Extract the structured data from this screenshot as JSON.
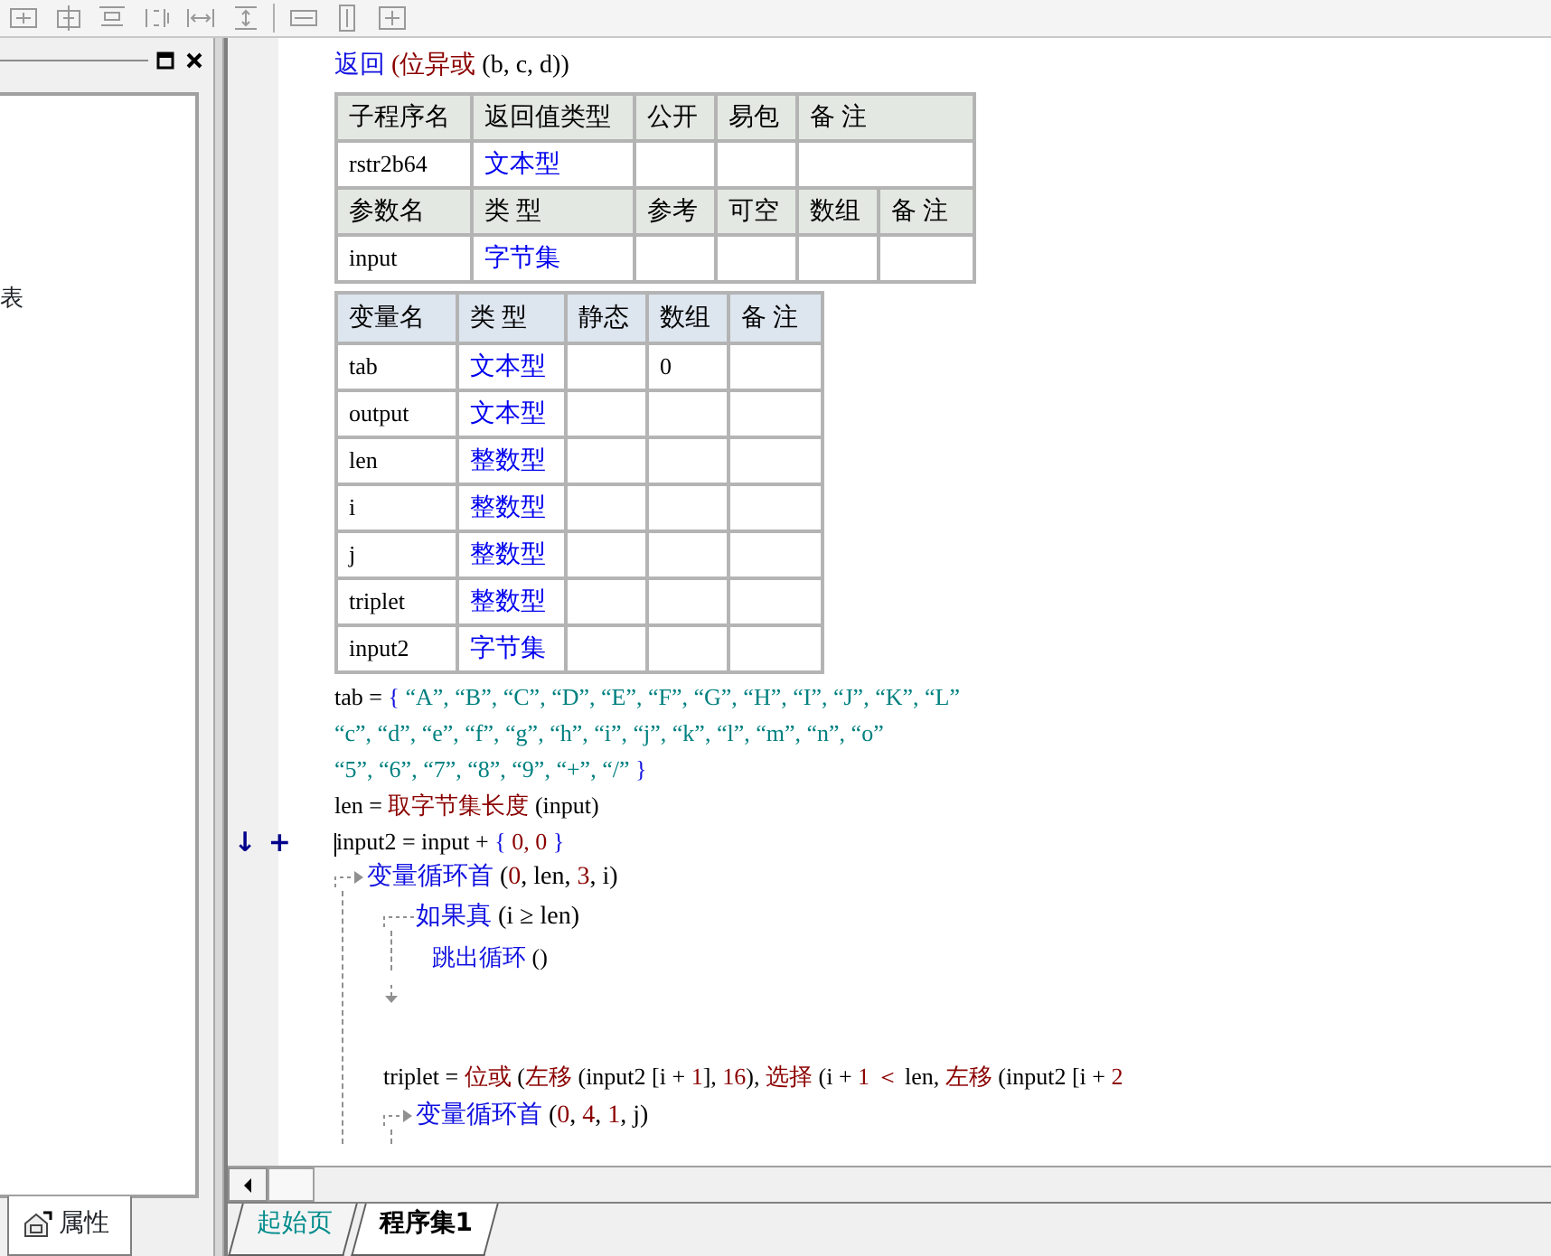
{
  "left_panel": {
    "list_text": "表",
    "tabs": [
      {
        "label": "属性",
        "selected": true
      }
    ]
  },
  "editor": {
    "return_line": [
      {
        "kind": "kw",
        "text": "返回"
      },
      {
        "kind": "fn",
        "text": " (位异或"
      },
      {
        "kind": "plain",
        "text": " (b, c, d))"
      }
    ],
    "sub_table": {
      "columns": [
        "子程序名",
        "返回值类型",
        "公开",
        "易包",
        "备 注"
      ],
      "row": {
        "name": "rstr2b64",
        "return_type": "文本型"
      }
    },
    "param_table": {
      "columns": [
        "参数名",
        "类 型",
        "参考",
        "可空",
        "数组",
        "备 注"
      ],
      "rows": [
        {
          "name": "input",
          "type": "字节集"
        }
      ]
    },
    "var_table": {
      "columns": [
        "变量名",
        "类 型",
        "静态",
        "数组",
        "备 注"
      ],
      "rows": [
        {
          "name": "tab",
          "type": "文本型",
          "array": "0"
        },
        {
          "name": "output",
          "type": "文本型"
        },
        {
          "name": "len",
          "type": "整数型"
        },
        {
          "name": "i",
          "type": "整数型"
        },
        {
          "name": "j",
          "type": "整数型"
        },
        {
          "name": "triplet",
          "type": "整数型"
        },
        {
          "name": "input2",
          "type": "字节集"
        }
      ]
    },
    "code": [
      {
        "kind": "line",
        "segments": [
          {
            "kind": "plain",
            "text": "tab = "
          },
          {
            "kind": "brace",
            "text": "{ "
          },
          {
            "kind": "str",
            "text": "“A”, “B”, “C”, “D”, “E”, “F”, “G”, “H”, “I”, “J”, “K”, “L”"
          }
        ]
      },
      {
        "kind": "line",
        "segments": [
          {
            "kind": "str",
            "text": "“c”, “d”, “e”, “f”, “g”, “h”, “i”, “j”, “k”, “l”, “m”, “n”, “o”"
          }
        ]
      },
      {
        "kind": "line",
        "segments": [
          {
            "kind": "str",
            "text": "“5”, “6”, “7”, “8”, “9”, “+”, “/”"
          },
          {
            "kind": "brace",
            "text": " }"
          }
        ]
      },
      {
        "kind": "line",
        "segments": [
          {
            "kind": "plain",
            "text": "len = "
          },
          {
            "kind": "fn",
            "text": "取字节集长度"
          },
          {
            "kind": "plain",
            "text": " (input)"
          }
        ]
      },
      {
        "kind": "line",
        "gutter_marks": [
          "↓",
          "+"
        ],
        "cursor": true,
        "segments": [
          {
            "kind": "plain",
            "text": "input2 = input + "
          },
          {
            "kind": "brace",
            "text": "{ "
          },
          {
            "kind": "num",
            "text": "0, 0"
          },
          {
            "kind": "brace",
            "text": " }"
          }
        ]
      },
      {
        "kind": "loop",
        "segments": [
          {
            "kind": "kw",
            "text": "变量循环首"
          },
          {
            "kind": "plain",
            "text": " ("
          },
          {
            "kind": "num",
            "text": "0"
          },
          {
            "kind": "plain",
            "text": ", len, "
          },
          {
            "kind": "num",
            "text": "3"
          },
          {
            "kind": "plain",
            "text": ", i)"
          }
        ],
        "children": [
          {
            "kind": "if",
            "segments": [
              {
                "kind": "kw",
                "text": "如果真"
              },
              {
                "kind": "plain",
                "text": " (i ≥ len)"
              }
            ],
            "children": [
              {
                "kind": "line",
                "segments": [
                  {
                    "kind": "kw",
                    "text": "跳出循环"
                  },
                  {
                    "kind": "plain",
                    "text": " ()"
                  }
                ]
              }
            ]
          },
          {
            "kind": "blank"
          },
          {
            "kind": "line",
            "segments": [
              {
                "kind": "plain",
                "text": "triplet = "
              },
              {
                "kind": "fn",
                "text": "位或"
              },
              {
                "kind": "plain",
                "text": " ("
              },
              {
                "kind": "fn",
                "text": "左移"
              },
              {
                "kind": "plain",
                "text": " (input2 [i + "
              },
              {
                "kind": "num",
                "text": "1"
              },
              {
                "kind": "plain",
                "text": "], "
              },
              {
                "kind": "num",
                "text": "16"
              },
              {
                "kind": "plain",
                "text": "), "
              },
              {
                "kind": "fn",
                "text": "选择"
              },
              {
                "kind": "plain",
                "text": " (i + "
              },
              {
                "kind": "num",
                "text": "1"
              },
              {
                "kind": "fn",
                "text": " ＜ "
              },
              {
                "kind": "plain",
                "text": "len, "
              },
              {
                "kind": "fn",
                "text": "左移"
              },
              {
                "kind": "plain",
                "text": " (input2 [i + "
              },
              {
                "kind": "num",
                "text": "2"
              }
            ]
          },
          {
            "kind": "loop",
            "segments": [
              {
                "kind": "kw",
                "text": "变量循环首"
              },
              {
                "kind": "plain",
                "text": " ("
              },
              {
                "kind": "num",
                "text": "0"
              },
              {
                "kind": "plain",
                "text": ", "
              },
              {
                "kind": "num",
                "text": "4"
              },
              {
                "kind": "plain",
                "text": ", "
              },
              {
                "kind": "num",
                "text": "1"
              },
              {
                "kind": "plain",
                "text": ", j)"
              }
            ]
          }
        ]
      }
    ],
    "tabs": [
      {
        "label": "起始页",
        "selected": false
      },
      {
        "label": "程序集1",
        "selected": true
      }
    ]
  }
}
